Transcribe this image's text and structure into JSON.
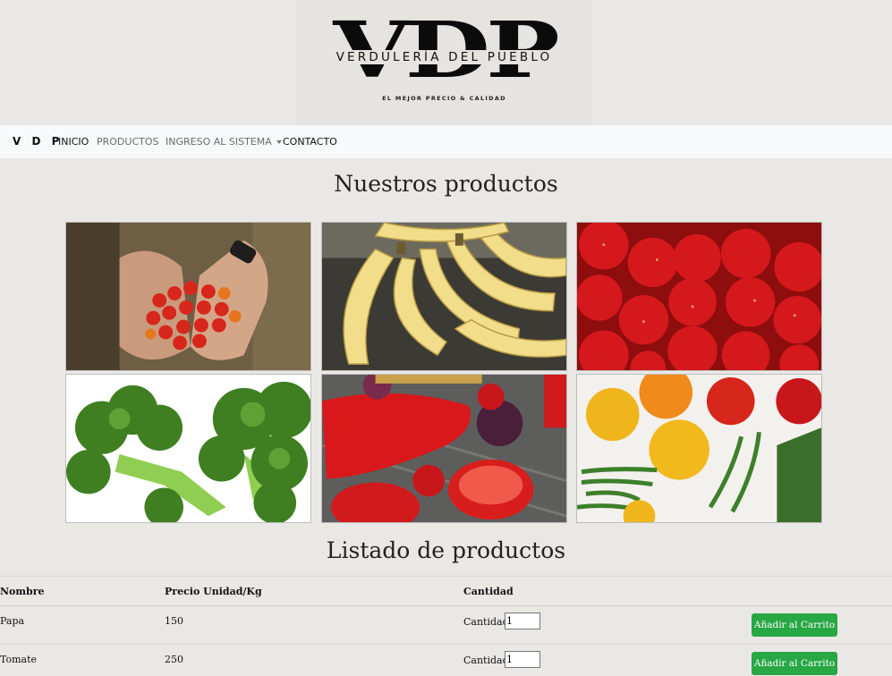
{
  "header": {
    "logo_letters": "VDP",
    "logo_name": "VERDULERÍA DEL PUEBLO",
    "logo_tagline": "EL MEJOR PRECIO & CALIDAD"
  },
  "navbar": {
    "brand": "V D P",
    "links": [
      {
        "label": "INICIO"
      },
      {
        "label": "PRODUCTOS"
      },
      {
        "label": "INGRESO AL SISTEMA"
      },
      {
        "label": "CONTACTO"
      }
    ],
    "dropdown_icon": "caret-down-icon"
  },
  "gallery": {
    "title": "Nuestros productos",
    "images": [
      {
        "subject": "cherry tomatoes in hands"
      },
      {
        "subject": "bananas"
      },
      {
        "subject": "strawberries"
      },
      {
        "subject": "broccoli"
      },
      {
        "subject": "red peppers and tomatoes"
      },
      {
        "subject": "peppers and green beans"
      }
    ]
  },
  "listing": {
    "title": "Listado de productos",
    "columns": [
      "Nombre",
      "Precio Unidad/Kg",
      "Cantidad"
    ],
    "rows": [
      {
        "name": "Papa",
        "price": "150",
        "qty_label": "Cantidad:",
        "qty_value": "1",
        "button": "Añadir al Carrito"
      },
      {
        "name": "Tomate",
        "price": "250",
        "qty_label": "Cantidad:",
        "qty_value": "1",
        "button": "Añadir al Carrito"
      }
    ]
  },
  "colors": {
    "page_bg": "#e9e8e5",
    "navbar_bg": "#f8f9fa",
    "button_green": "#28a745"
  }
}
